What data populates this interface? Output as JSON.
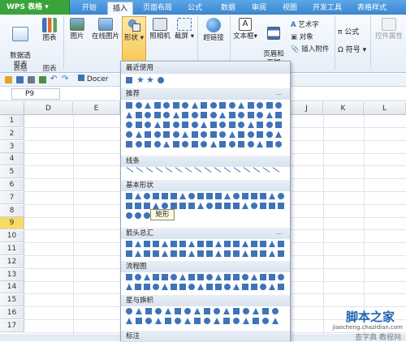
{
  "app": {
    "name": "WPS 表格"
  },
  "tabs": [
    {
      "label": "开始"
    },
    {
      "label": "插入"
    },
    {
      "label": "页面布局"
    },
    {
      "label": "公式"
    },
    {
      "label": "数据"
    },
    {
      "label": "审阅"
    },
    {
      "label": "视图"
    },
    {
      "label": "开发工具"
    },
    {
      "label": "表格样式"
    }
  ],
  "ribbon": {
    "pivot": "数据透\n视表",
    "pivot_group": "表格",
    "chart": "图表",
    "chart_group": "图表",
    "picture": "图片",
    "online_picture": "在线图片",
    "shapes": "形状",
    "camera": "照相机",
    "screenshot": "截屏",
    "hyperlink": "超链接",
    "textbox": "文本框",
    "header_footer": "页眉和\n页脚",
    "wordart": "艺术字",
    "object": "对象",
    "attachment": "插入附件",
    "formula": "公式",
    "symbol": "符号",
    "widget": "控件属性"
  },
  "qat": {
    "docer": "Docer"
  },
  "formula": {
    "cell_ref": "P9"
  },
  "columns": [
    "D",
    "E",
    "J",
    "K",
    "L"
  ],
  "rows": [
    "1",
    "2",
    "3",
    "4",
    "5",
    "6",
    "7",
    "8",
    "9",
    "10",
    "11",
    "12",
    "13",
    "14",
    "15",
    "16",
    "17"
  ],
  "selected_row": "9",
  "panel": {
    "recent": "最近使用",
    "recommended": "推荐",
    "lines": "线条",
    "basic": "基本形状",
    "arrows": "箭头总汇",
    "flowchart": "流程图",
    "stars": "星与旗帜",
    "callouts": "标注",
    "more": "..."
  },
  "tooltip": "矩形",
  "watermark": {
    "line1": "脚本之家",
    "line2": "jiaocheng.chazidian.com",
    "line3": "查字典 教程网"
  },
  "colors": {
    "accent": "#3b86cf",
    "shape": "#3f73b8",
    "selected_row": "#f6dc62",
    "app_green": "#3aa33a"
  }
}
